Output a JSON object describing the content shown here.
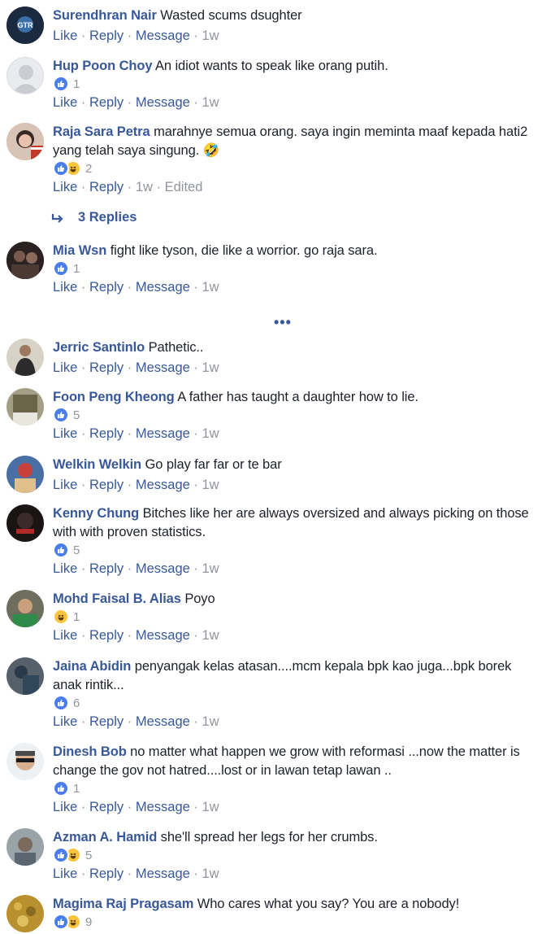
{
  "actions": {
    "like": "Like",
    "reply": "Reply",
    "message": "Message",
    "time": "1w",
    "edited": "Edited",
    "dot": "·"
  },
  "replies_label": "3 Replies",
  "more_label": "•••",
  "comments": [
    {
      "name": "Surendhran Nair",
      "text": "Wasted scums dsughter",
      "reactions": [],
      "count": ""
    },
    {
      "name": "Hup Poon Choy",
      "text": "An idiot wants to speak like orang putih.",
      "reactions": [
        "like"
      ],
      "count": "1"
    },
    {
      "name": "Raja Sara Petra",
      "text": "marahnye semua orang. saya ingin meminta maaf kepada hati2 yang telah saya singung. 🤣",
      "reactions": [
        "like",
        "haha"
      ],
      "count": "2"
    },
    {
      "name": "Mia Wsn",
      "text": "fight like tyson, die like a worrior. go raja sara.",
      "reactions": [
        "like"
      ],
      "count": "1"
    },
    {
      "name": "Jerric Santinlo",
      "text": "Pathetic..",
      "reactions": [],
      "count": ""
    },
    {
      "name": "Foon Peng Kheong",
      "text": "A father has taught a daughter how to lie.",
      "reactions": [
        "like"
      ],
      "count": "5"
    },
    {
      "name": "Welkin Welkin",
      "text": "Go play far far or te bar",
      "reactions": [],
      "count": ""
    },
    {
      "name": "Kenny Chung",
      "text": "Bitches like her are always oversized and always picking on those with with proven statistics.",
      "reactions": [
        "like"
      ],
      "count": "5"
    },
    {
      "name": "Mohd Faisal B. Alias",
      "text": "Poyo",
      "reactions": [
        "haha"
      ],
      "count": "1"
    },
    {
      "name": "Jaina Abidin",
      "text": "penyangak kelas atasan....mcm kepala bpk kao juga...bpk borek anak rintik...",
      "reactions": [
        "like"
      ],
      "count": "6"
    },
    {
      "name": "Dinesh Bob",
      "text": "no matter what happen we grow with reformasi ...now the matter is change the gov not hatred....lost or in lawan tetap lawan ..",
      "reactions": [
        "like"
      ],
      "count": "1"
    },
    {
      "name": "Azman A. Hamid",
      "text": "she'll spread her legs for her crumbs.",
      "reactions": [
        "like",
        "haha"
      ],
      "count": "5"
    },
    {
      "name": "Magima Raj Pragasam",
      "text": "Who cares what you say? You are a nobody!",
      "reactions": [
        "like",
        "haha"
      ],
      "count": "9"
    }
  ]
}
